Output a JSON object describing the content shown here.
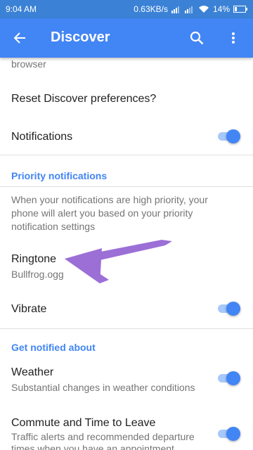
{
  "status_bar": {
    "time": "9:04 AM",
    "speed": "0.63KB/s",
    "battery": "14%"
  },
  "app_bar": {
    "title": "Discover",
    "back_icon": "arrow-back-icon",
    "search_icon": "search-icon",
    "menu_icon": "more-vert-icon"
  },
  "settings": {
    "clipped_text": "browser",
    "reset": {
      "label": "Reset Discover preferences?"
    },
    "notifications": {
      "label": "Notifications",
      "enabled": true
    },
    "priority_section": {
      "header": "Priority notifications",
      "description": "When your notifications are high priority, your phone will alert you based on your priority notification settings"
    },
    "ringtone": {
      "label": "Ringtone",
      "value": "Bullfrog.ogg"
    },
    "vibrate": {
      "label": "Vibrate",
      "enabled": true
    },
    "notified_section": {
      "header": "Get notified about"
    },
    "weather": {
      "label": "Weather",
      "description": "Substantial changes in weather conditions",
      "enabled": true
    },
    "commute": {
      "label": "Commute and Time to Leave",
      "description": "Traffic alerts and recommended departure times when you have an appointment",
      "enabled": true
    }
  },
  "colors": {
    "accent": "#4285f4",
    "status_bar": "#3b82d6",
    "annotation_arrow": "#9b6fd6"
  }
}
